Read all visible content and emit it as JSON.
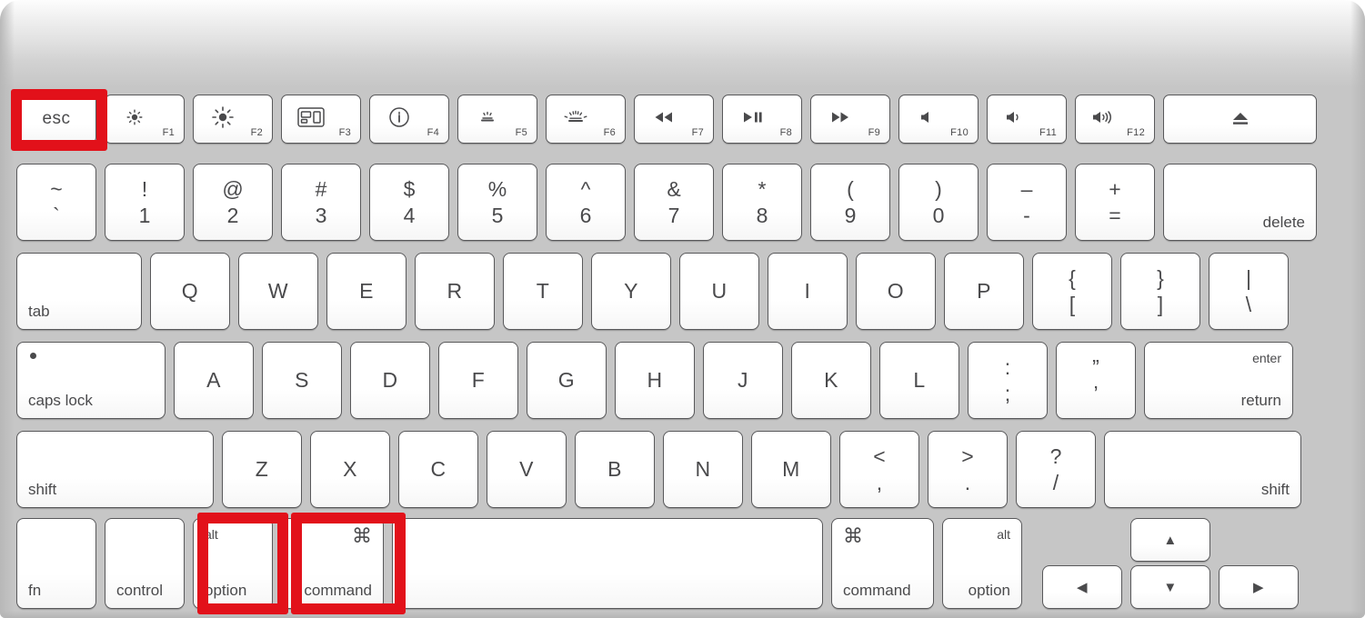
{
  "device": {
    "name": "apple-wireless-keyboard",
    "highlight_color": "#e2111a",
    "body_color": "#c6c6c6",
    "key_color": "#ffffff"
  },
  "highlighted_keys": [
    "esc",
    "option",
    "command"
  ],
  "rows": {
    "function": [
      {
        "name": "esc",
        "label": "esc",
        "highlighted": true
      },
      {
        "name": "f1-brightness-down",
        "icon": "brightness-down-icon",
        "fkey": "F1"
      },
      {
        "name": "f2-brightness-up",
        "icon": "brightness-up-icon",
        "fkey": "F2"
      },
      {
        "name": "f3-mission-control",
        "icon": "mission-control-icon",
        "fkey": "F3"
      },
      {
        "name": "f4-launchpad",
        "icon": "launchpad-icon",
        "fkey": "F4"
      },
      {
        "name": "f5-keyboard-backlight-down",
        "icon": "keyboard-backlight-down-icon",
        "fkey": "F5"
      },
      {
        "name": "f6-keyboard-backlight-up",
        "icon": "keyboard-backlight-up-icon",
        "fkey": "F6"
      },
      {
        "name": "f7-rewind",
        "icon": "rewind-icon",
        "fkey": "F7"
      },
      {
        "name": "f8-play-pause",
        "icon": "play-pause-icon",
        "fkey": "F8"
      },
      {
        "name": "f9-fast-forward",
        "icon": "fast-forward-icon",
        "fkey": "F9"
      },
      {
        "name": "f10-mute",
        "icon": "mute-icon",
        "fkey": "F10"
      },
      {
        "name": "f11-volume-down",
        "icon": "volume-down-icon",
        "fkey": "F11"
      },
      {
        "name": "f12-volume-up",
        "icon": "volume-up-icon",
        "fkey": "F12"
      },
      {
        "name": "eject",
        "icon": "eject-icon",
        "fkey": ""
      }
    ],
    "number": [
      {
        "name": "tilde",
        "upper": "~",
        "lower": "`"
      },
      {
        "name": "one",
        "upper": "!",
        "lower": "1"
      },
      {
        "name": "two",
        "upper": "@",
        "lower": "2"
      },
      {
        "name": "three",
        "upper": "#",
        "lower": "3"
      },
      {
        "name": "four",
        "upper": "$",
        "lower": "4"
      },
      {
        "name": "five",
        "upper": "%",
        "lower": "5"
      },
      {
        "name": "six",
        "upper": "^",
        "lower": "6"
      },
      {
        "name": "seven",
        "upper": "&",
        "lower": "7"
      },
      {
        "name": "eight",
        "upper": "*",
        "lower": "8"
      },
      {
        "name": "nine",
        "upper": "(",
        "lower": "9"
      },
      {
        "name": "zero",
        "upper": ")",
        "lower": "0"
      },
      {
        "name": "hyphen",
        "upper": "–",
        "lower": "-"
      },
      {
        "name": "equals",
        "upper": "+",
        "lower": "="
      },
      {
        "name": "delete",
        "label": "delete"
      }
    ],
    "qwerty": [
      {
        "name": "tab",
        "label": "tab"
      },
      {
        "name": "q",
        "label": "Q"
      },
      {
        "name": "w",
        "label": "W"
      },
      {
        "name": "e",
        "label": "E"
      },
      {
        "name": "r",
        "label": "R"
      },
      {
        "name": "t",
        "label": "T"
      },
      {
        "name": "y",
        "label": "Y"
      },
      {
        "name": "u",
        "label": "U"
      },
      {
        "name": "i",
        "label": "I"
      },
      {
        "name": "o",
        "label": "O"
      },
      {
        "name": "p",
        "label": "P"
      },
      {
        "name": "bracket-left",
        "upper": "{",
        "lower": "["
      },
      {
        "name": "bracket-right",
        "upper": "}",
        "lower": "]"
      },
      {
        "name": "backslash",
        "upper": "|",
        "lower": "\\"
      }
    ],
    "home": [
      {
        "name": "caps-lock",
        "label": "caps lock"
      },
      {
        "name": "a",
        "label": "A"
      },
      {
        "name": "s",
        "label": "S"
      },
      {
        "name": "d",
        "label": "D"
      },
      {
        "name": "f",
        "label": "F"
      },
      {
        "name": "g",
        "label": "G"
      },
      {
        "name": "h",
        "label": "H"
      },
      {
        "name": "j",
        "label": "J"
      },
      {
        "name": "k",
        "label": "K"
      },
      {
        "name": "l",
        "label": "L"
      },
      {
        "name": "semicolon",
        "upper": ":",
        "lower": ";"
      },
      {
        "name": "quote",
        "upper": "”",
        "lower": "’"
      },
      {
        "name": "return",
        "upper_label": "enter",
        "lower_label": "return"
      }
    ],
    "shift": [
      {
        "name": "shift-left",
        "label": "shift"
      },
      {
        "name": "z",
        "label": "Z"
      },
      {
        "name": "x",
        "label": "X"
      },
      {
        "name": "c",
        "label": "C"
      },
      {
        "name": "v",
        "label": "V"
      },
      {
        "name": "b",
        "label": "B"
      },
      {
        "name": "n",
        "label": "N"
      },
      {
        "name": "m",
        "label": "M"
      },
      {
        "name": "comma",
        "upper": "<",
        "lower": ","
      },
      {
        "name": "period",
        "upper": ">",
        "lower": "."
      },
      {
        "name": "slash",
        "upper": "?",
        "lower": "/"
      },
      {
        "name": "shift-right",
        "label": "shift"
      }
    ],
    "bottom": [
      {
        "name": "fn",
        "label": "fn"
      },
      {
        "name": "control",
        "label": "control"
      },
      {
        "name": "option-left",
        "upper_label": "alt",
        "lower_label": "option",
        "highlighted": true
      },
      {
        "name": "command-left",
        "symbol": "⌘",
        "lower_label": "command",
        "highlighted": true
      },
      {
        "name": "space",
        "label": ""
      },
      {
        "name": "command-right",
        "symbol": "⌘",
        "lower_label": "command"
      },
      {
        "name": "option-right",
        "upper_label": "alt",
        "lower_label": "option"
      },
      {
        "name": "arrow-left",
        "label": "◀"
      },
      {
        "name": "arrow-up",
        "label": "▲"
      },
      {
        "name": "arrow-down",
        "label": "▼"
      },
      {
        "name": "arrow-right",
        "label": "▶"
      }
    ]
  }
}
